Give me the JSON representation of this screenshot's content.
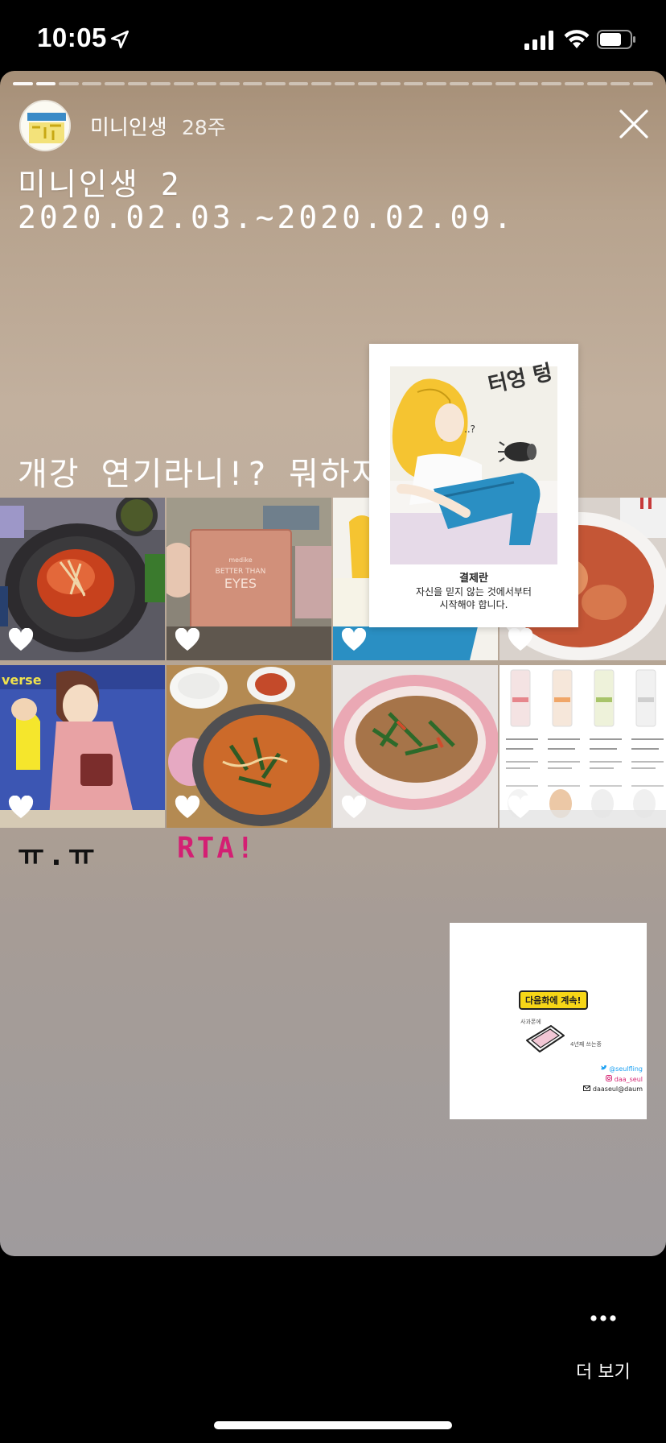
{
  "status_bar": {
    "time": "10:05"
  },
  "header": {
    "account_name": "미니인생",
    "post_age": "28주",
    "avatar_text": "미니인생",
    "progress_total": 28,
    "progress_done": 2
  },
  "story": {
    "title": "미니인생 2",
    "date_range": "2020.02.03.~2020.02.09.",
    "caption": "개강 연기라니!? 뭐하지"
  },
  "grid": {
    "tiles": [
      {
        "name": "tteokbokki-pan-photo"
      },
      {
        "name": "eyeshadow-palette-photo",
        "brand": "medike",
        "product_line1": "BETTER THAN",
        "product_line2": "EYES"
      },
      {
        "name": "webtoon-crop-photo"
      },
      {
        "name": "spicy-food-bowl-photo"
      },
      {
        "name": "cartoon-still-photo",
        "tag": "verse"
      },
      {
        "name": "ramen-pot-photo"
      },
      {
        "name": "japchae-plate-photo"
      },
      {
        "name": "sunscreen-comparison-photo"
      }
    ]
  },
  "captions": {
    "sad": "ㅠ.ㅠ",
    "rta": "RTA!"
  },
  "webtoon_sticker": {
    "sfx": "터엉 텅",
    "question_marks": "..?",
    "line1": "결제란",
    "line2": "자신을 믿지 않는 것에서부터",
    "line3": "시작해야 합니다."
  },
  "next_episode_card": {
    "bubble": "다음화에 계속!",
    "small_left": "사과폰에",
    "small_right": "4년째 쓰는중",
    "twitter": "@seulfling",
    "instagram": "daa_seul",
    "email": "daaseul@daum"
  },
  "footer": {
    "more_label": "더 보기"
  },
  "colors": {
    "rta": "#d41f73",
    "card_top": "#a68f77",
    "card_bottom": "#9f9b9d"
  }
}
